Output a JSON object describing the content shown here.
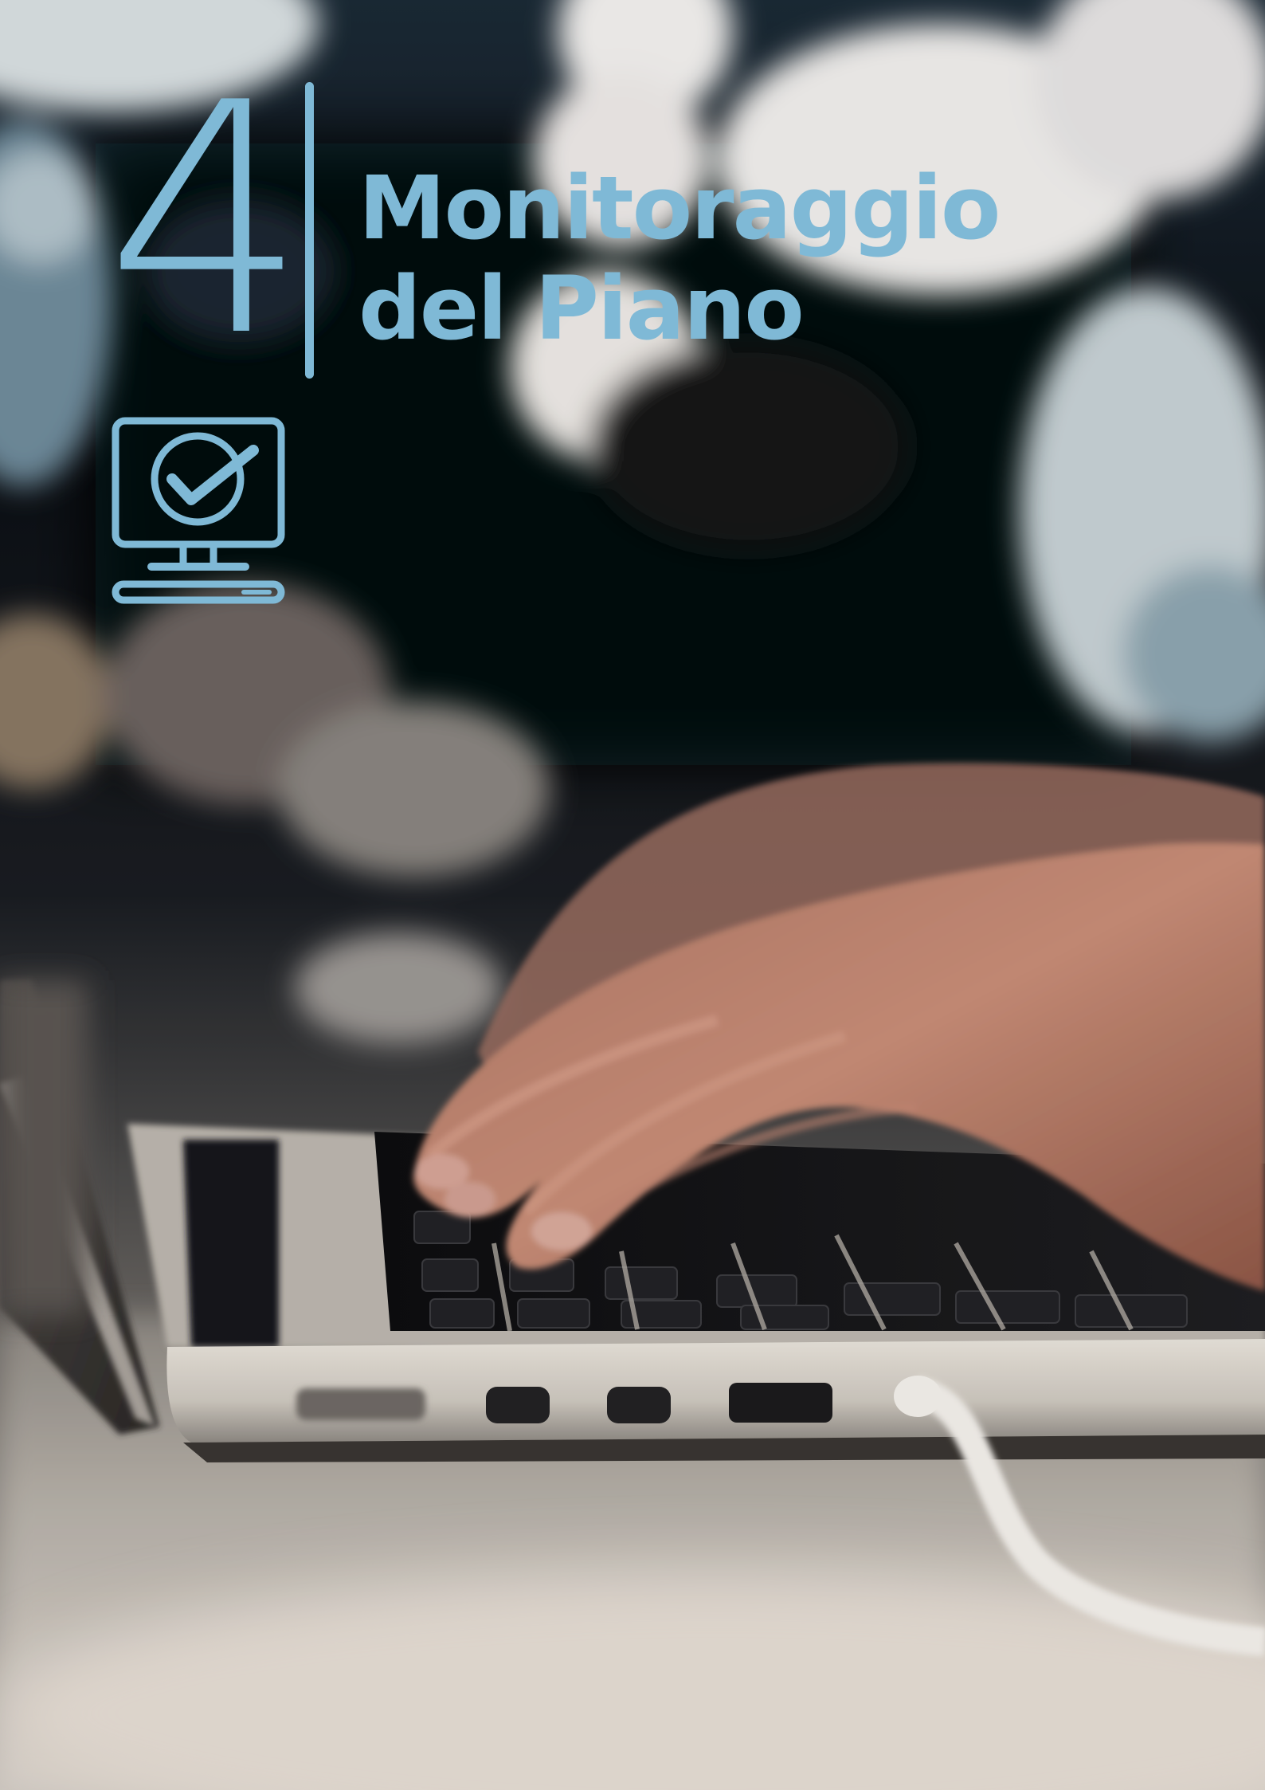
{
  "chapter": {
    "number": "4",
    "title_line_1": "Monitoraggio",
    "title_line_2": "del Piano"
  },
  "icons": {
    "chapter_icon": "monitor-check-icon"
  },
  "colors": {
    "accent": "#7fb9d6"
  }
}
